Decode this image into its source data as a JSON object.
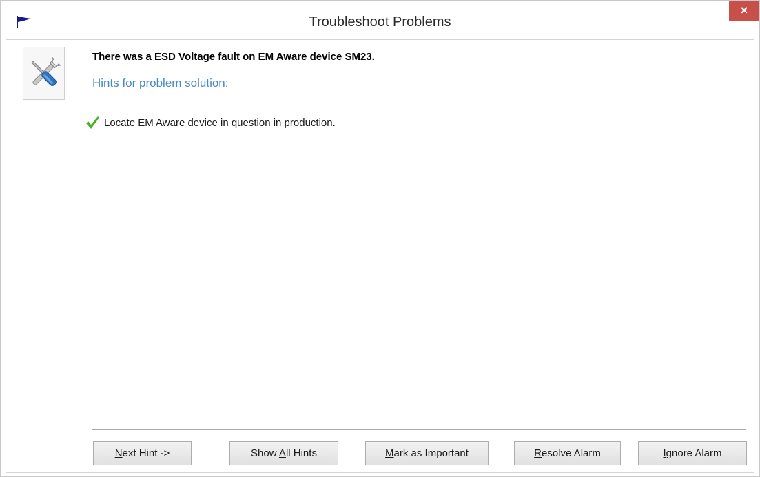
{
  "window": {
    "title": "Troubleshoot Problems",
    "close_label": "×",
    "app_icon": "flag-icon"
  },
  "problem": {
    "icon": "tools-icon",
    "message": "There was a ESD Voltage fault on EM Aware device SM23."
  },
  "hints": {
    "heading": "Hints for problem solution:",
    "items": [
      {
        "icon": "checkmark-icon",
        "text": "Locate EM Aware device in question in production.",
        "status_color": "#4caf26"
      }
    ]
  },
  "buttons": {
    "next_hint": {
      "mnemonic": "N",
      "rest": "ext Hint ->"
    },
    "show_all_hints": {
      "before": "Show ",
      "mnemonic": "A",
      "rest": "ll Hints"
    },
    "mark_important": {
      "mnemonic": "M",
      "rest": "ark as Important"
    },
    "resolve_alarm": {
      "mnemonic": "R",
      "rest": "esolve Alarm"
    },
    "ignore_alarm": {
      "mnemonic": "I",
      "rest": "gnore Alarm"
    }
  },
  "colors": {
    "close_button": "#c7504a",
    "hints_heading": "#4a8ac4",
    "flag": "#1a1a8c"
  }
}
